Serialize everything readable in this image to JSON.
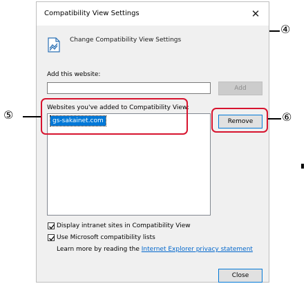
{
  "dialog": {
    "title": "Compatibility View Settings",
    "close_glyph": "✕",
    "header": {
      "icon": "compat-view-icon",
      "text": "Change Compatibility View Settings"
    },
    "add_label": "Add this website:",
    "add_input_value": "",
    "add_button": "Add",
    "list_label": "Websites you've added to Compatibility View:",
    "list_items": [
      "gs-sakainet.com"
    ],
    "remove_button": "Remove",
    "checkbox_intranet": {
      "label": "Display intranet sites in Compatibility View",
      "checked": true
    },
    "checkbox_ms_lists": {
      "label": "Use Microsoft compatibility lists",
      "checked": true
    },
    "learn_more_prefix": "Learn more by reading the ",
    "learn_more_link": "Internet Explorer privacy statement",
    "close_button": "Close"
  },
  "callouts": {
    "c4": "④",
    "c5": "⑤",
    "c6": "⑥"
  },
  "colors": {
    "highlight_border": "#d7132e",
    "selection": "#0078d7",
    "link": "#0066cc"
  }
}
